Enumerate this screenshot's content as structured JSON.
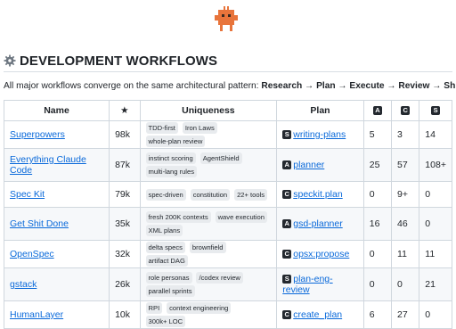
{
  "heading": "DEVELOPMENT WORKFLOWS",
  "intro": {
    "prefix": "All major workflows converge on the same architectural pattern: ",
    "pattern": "Research → Plan → Execute → Review → Ship"
  },
  "table": {
    "headers": {
      "name": "Name",
      "stars": "★",
      "uniqueness": "Uniqueness",
      "plan": "Plan",
      "col_a": "A",
      "col_c": "C",
      "col_s": "S"
    },
    "rows": [
      {
        "name": "Superpowers",
        "stars": "98k",
        "tags": [
          "TDD-first",
          "Iron Laws",
          "whole-plan review"
        ],
        "plan_badge": "S",
        "plan": "writing-plans",
        "a": "5",
        "c": "3",
        "s": "14"
      },
      {
        "name": "Everything Claude Code",
        "stars": "87k",
        "tags": [
          "instinct scoring",
          "AgentShield",
          "multi-lang rules"
        ],
        "plan_badge": "A",
        "plan": "planner",
        "a": "25",
        "c": "57",
        "s": "108+"
      },
      {
        "name": "Spec Kit",
        "stars": "79k",
        "tags": [
          "spec-driven",
          "constitution",
          "22+ tools"
        ],
        "plan_badge": "C",
        "plan": "speckit.plan",
        "a": "0",
        "c": "9+",
        "s": "0"
      },
      {
        "name": "Get Shit Done",
        "stars": "35k",
        "tags": [
          "fresh 200K contexts",
          "wave execution",
          "XML plans"
        ],
        "plan_badge": "A",
        "plan": "gsd-planner",
        "a": "16",
        "c": "46",
        "s": "0"
      },
      {
        "name": "OpenSpec",
        "stars": "32k",
        "tags": [
          "delta specs",
          "brownfield",
          "artifact DAG"
        ],
        "plan_badge": "C",
        "plan": "opsx:propose",
        "a": "0",
        "c": "11",
        "s": "11"
      },
      {
        "name": "gstack",
        "stars": "26k",
        "tags": [
          "role personas",
          "/codex review",
          "parallel sprints"
        ],
        "plan_badge": "S",
        "plan": "plan-eng-review",
        "a": "0",
        "c": "0",
        "s": "21"
      },
      {
        "name": "HumanLayer",
        "stars": "10k",
        "tags": [
          "RPI",
          "context engineering",
          "300k+ LOC"
        ],
        "plan_badge": "C",
        "plan": "create_plan",
        "a": "6",
        "c": "27",
        "s": "0"
      }
    ]
  },
  "colors": {
    "link": "#0969da",
    "logo": "#e8743b",
    "tag_bg": "#e8ebee"
  },
  "icons": {
    "logo": "robot-mascot-icon",
    "heading": "gear-icon"
  }
}
